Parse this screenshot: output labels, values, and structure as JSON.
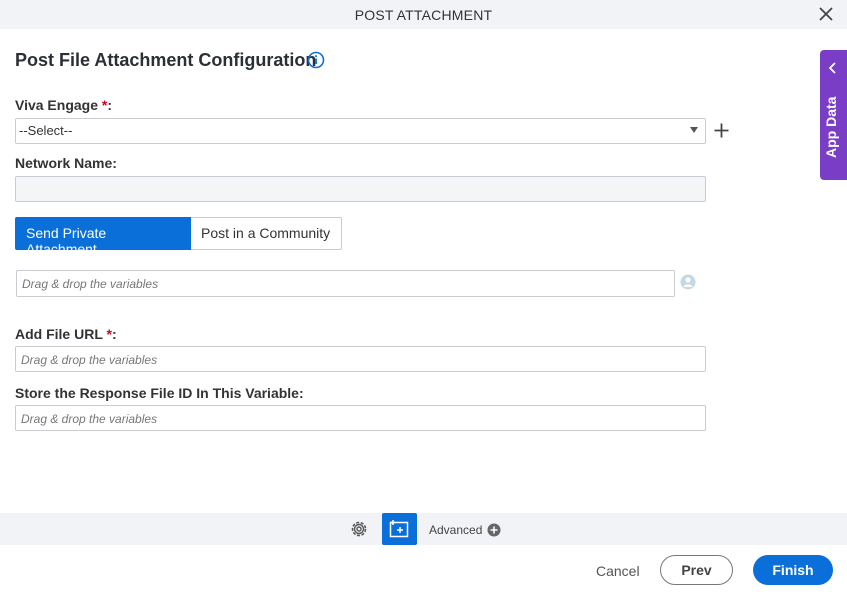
{
  "window": {
    "title": "POST ATTACHMENT"
  },
  "page": {
    "heading": "Post File Attachment Configuration"
  },
  "fields": {
    "viva_engage": {
      "label": "Viva Engage ",
      "required": "*",
      "colon": ":",
      "value": "--Select--"
    },
    "network_name": {
      "label": "Network Name:",
      "value": ""
    },
    "recipient": {
      "placeholder": "Drag & drop the variables"
    },
    "file_url": {
      "label": "Add File URL ",
      "required": "*",
      "colon": ":",
      "placeholder": "Drag & drop the variables"
    },
    "response_id": {
      "label": "Store the Response File ID In This Variable:",
      "placeholder": "Drag & drop the variables"
    }
  },
  "toggle": {
    "options": [
      "Send Private Attachment",
      "Post in a Community"
    ],
    "selected": "Send Private Attachment"
  },
  "toolbar": {
    "advanced_label": "Advanced"
  },
  "footer": {
    "cancel_label": "Cancel",
    "prev_label": "Prev",
    "finish_label": "Finish"
  },
  "side_panel": {
    "label": "App Data"
  },
  "colors": {
    "primary": "#0a6fd8",
    "side_panel": "#7a3ec6",
    "required": "#d0021b"
  },
  "icons": [
    "close-icon",
    "info-icon",
    "plus-icon",
    "user-icon",
    "gear-icon",
    "add-panel-icon",
    "plus-circle-icon",
    "chevron-left-icon"
  ]
}
